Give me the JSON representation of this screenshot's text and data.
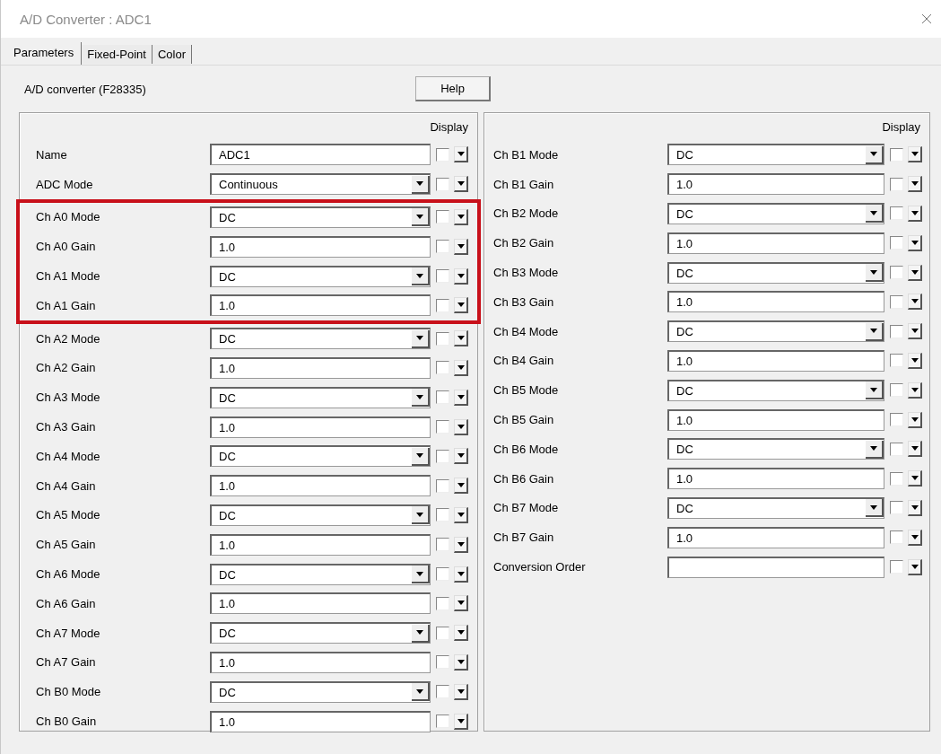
{
  "window": {
    "title": "A/D Converter : ADC1"
  },
  "tabs": [
    {
      "label": "Parameters",
      "selected": true
    },
    {
      "label": "Fixed-Point",
      "selected": false
    },
    {
      "label": "Color",
      "selected": false
    }
  ],
  "header": {
    "label": "A/D converter (F28335)",
    "help_button": "Help"
  },
  "panels": [
    {
      "display_heading": "Display",
      "rows": [
        {
          "label": "Name",
          "kind": "text",
          "value": "ADC1",
          "checked": false,
          "highlighted": false
        },
        {
          "label": "ADC Mode",
          "kind": "combo",
          "value": "Continuous",
          "checked": false,
          "highlighted": false
        },
        {
          "label": "Ch A0 Mode",
          "kind": "combo",
          "value": "DC",
          "checked": false,
          "highlighted": true
        },
        {
          "label": "Ch A0 Gain",
          "kind": "text",
          "value": "1.0",
          "checked": false,
          "highlighted": true
        },
        {
          "label": "Ch A1 Mode",
          "kind": "combo",
          "value": "DC",
          "checked": false,
          "highlighted": true
        },
        {
          "label": "Ch A1 Gain",
          "kind": "text",
          "value": "1.0",
          "checked": false,
          "highlighted": true
        },
        {
          "label": "Ch A2 Mode",
          "kind": "combo",
          "value": "DC",
          "checked": false,
          "highlighted": false
        },
        {
          "label": "Ch A2 Gain",
          "kind": "text",
          "value": "1.0",
          "checked": false,
          "highlighted": false
        },
        {
          "label": "Ch A3 Mode",
          "kind": "combo",
          "value": "DC",
          "checked": false,
          "highlighted": false
        },
        {
          "label": "Ch A3 Gain",
          "kind": "text",
          "value": "1.0",
          "checked": false,
          "highlighted": false
        },
        {
          "label": "Ch A4 Mode",
          "kind": "combo",
          "value": "DC",
          "checked": false,
          "highlighted": false
        },
        {
          "label": "Ch A4 Gain",
          "kind": "text",
          "value": "1.0",
          "checked": false,
          "highlighted": false
        },
        {
          "label": "Ch A5 Mode",
          "kind": "combo",
          "value": "DC",
          "checked": false,
          "highlighted": false
        },
        {
          "label": "Ch A5 Gain",
          "kind": "text",
          "value": "1.0",
          "checked": false,
          "highlighted": false
        },
        {
          "label": "Ch A6 Mode",
          "kind": "combo",
          "value": "DC",
          "checked": false,
          "highlighted": false
        },
        {
          "label": "Ch A6 Gain",
          "kind": "text",
          "value": "1.0",
          "checked": false,
          "highlighted": false
        },
        {
          "label": "Ch A7 Mode",
          "kind": "combo",
          "value": "DC",
          "checked": false,
          "highlighted": false
        },
        {
          "label": "Ch A7 Gain",
          "kind": "text",
          "value": "1.0",
          "checked": false,
          "highlighted": false
        },
        {
          "label": "Ch B0 Mode",
          "kind": "combo",
          "value": "DC",
          "checked": false,
          "highlighted": false
        },
        {
          "label": "Ch B0 Gain",
          "kind": "text",
          "value": "1.0",
          "checked": false,
          "highlighted": false
        }
      ]
    },
    {
      "display_heading": "Display",
      "rows": [
        {
          "label": "Ch B1 Mode",
          "kind": "combo",
          "value": "DC",
          "checked": false,
          "highlighted": false
        },
        {
          "label": "Ch B1 Gain",
          "kind": "text",
          "value": "1.0",
          "checked": false,
          "highlighted": false
        },
        {
          "label": "Ch B2 Mode",
          "kind": "combo",
          "value": "DC",
          "checked": false,
          "highlighted": false
        },
        {
          "label": "Ch B2 Gain",
          "kind": "text",
          "value": "1.0",
          "checked": false,
          "highlighted": false
        },
        {
          "label": "Ch B3 Mode",
          "kind": "combo",
          "value": "DC",
          "checked": false,
          "highlighted": false
        },
        {
          "label": "Ch B3 Gain",
          "kind": "text",
          "value": "1.0",
          "checked": false,
          "highlighted": false
        },
        {
          "label": "Ch B4 Mode",
          "kind": "combo",
          "value": "DC",
          "checked": false,
          "highlighted": false
        },
        {
          "label": "Ch B4 Gain",
          "kind": "text",
          "value": "1.0",
          "checked": false,
          "highlighted": false
        },
        {
          "label": "Ch B5 Mode",
          "kind": "combo",
          "value": "DC",
          "checked": false,
          "highlighted": false
        },
        {
          "label": "Ch B5 Gain",
          "kind": "text",
          "value": "1.0",
          "checked": false,
          "highlighted": false
        },
        {
          "label": "Ch B6 Mode",
          "kind": "combo",
          "value": "DC",
          "checked": false,
          "highlighted": false
        },
        {
          "label": "Ch B6 Gain",
          "kind": "text",
          "value": "1.0",
          "checked": false,
          "highlighted": false
        },
        {
          "label": "Ch B7 Mode",
          "kind": "combo",
          "value": "DC",
          "checked": false,
          "highlighted": false
        },
        {
          "label": "Ch B7 Gain",
          "kind": "text",
          "value": "1.0",
          "checked": false,
          "highlighted": false
        },
        {
          "label": "Conversion Order",
          "kind": "text",
          "checked": false,
          "highlighted": false
        }
      ]
    }
  ]
}
